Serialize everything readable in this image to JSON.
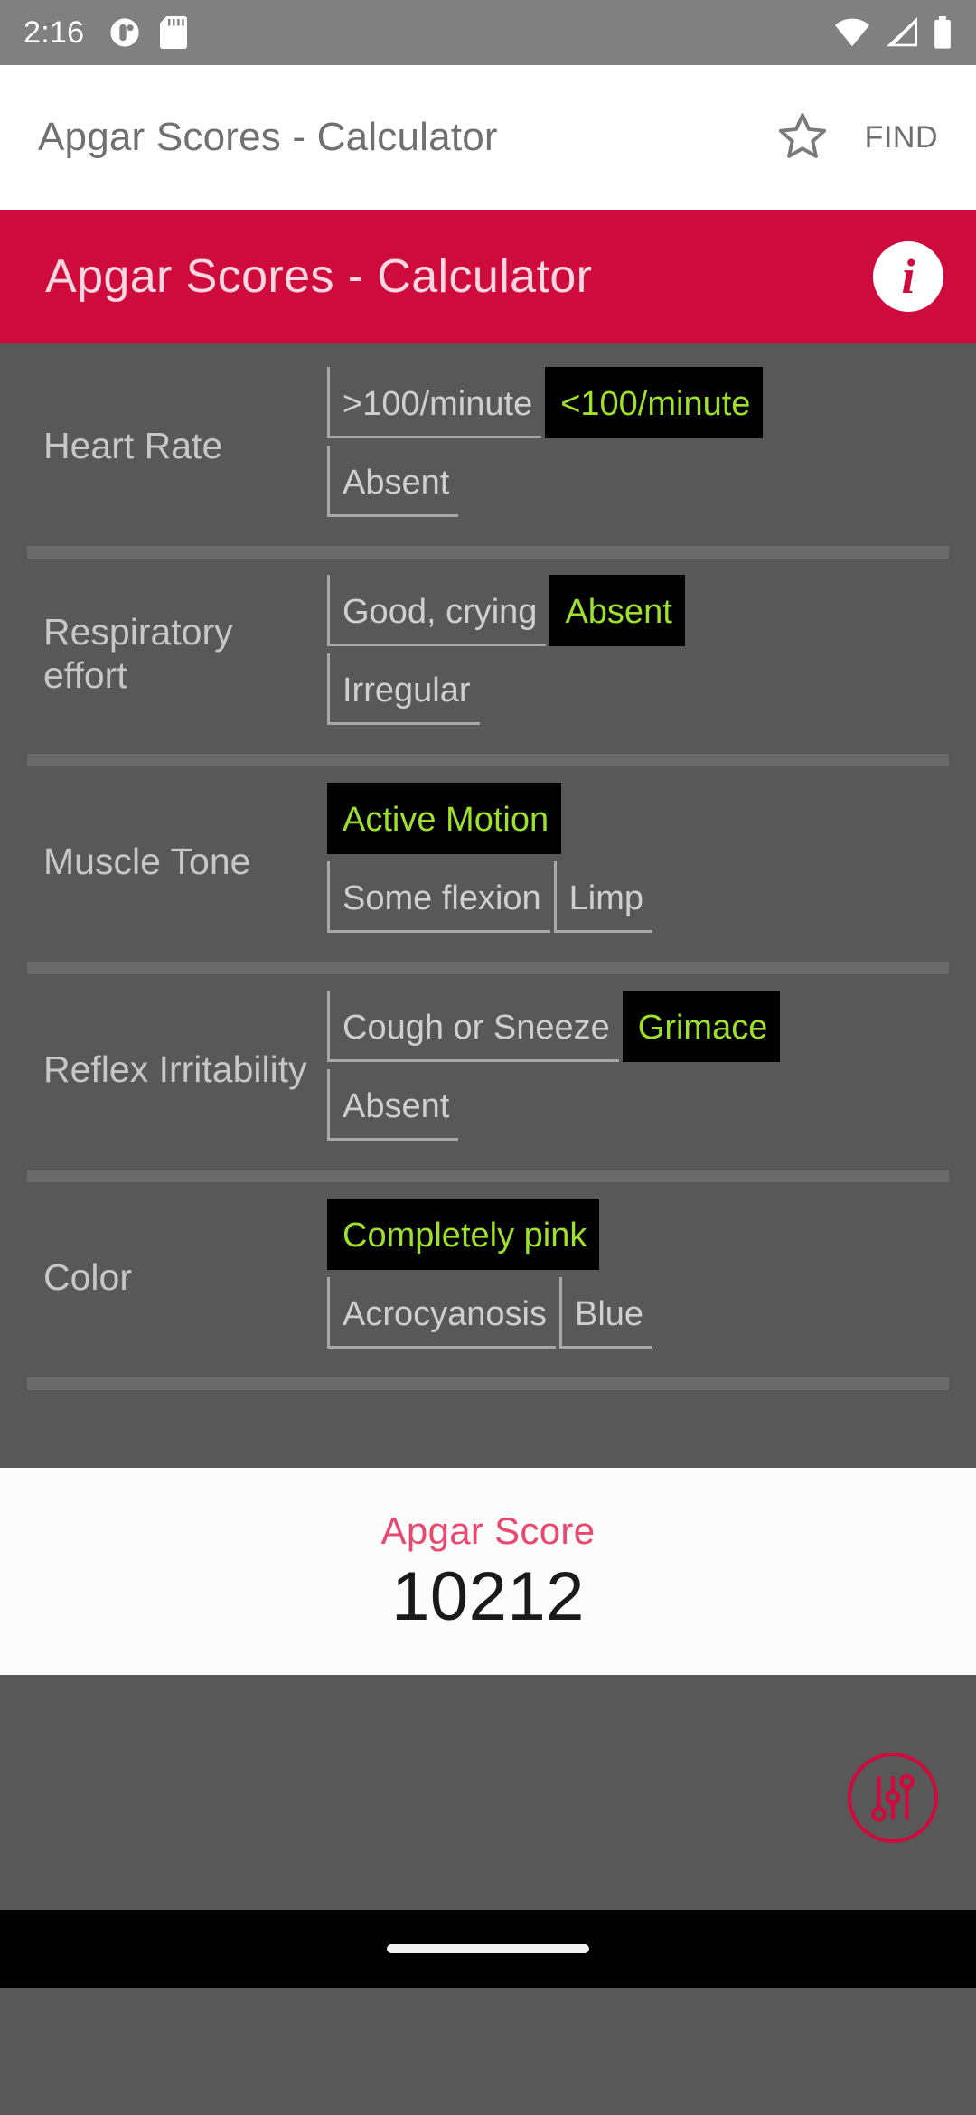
{
  "statusbar": {
    "clock": "2:16",
    "icons": [
      "notification-icon",
      "sd-card-icon",
      "wifi-icon",
      "cellular-signal-icon",
      "battery-icon"
    ]
  },
  "appbar": {
    "title": "Apgar Scores - Calculator",
    "star_icon": "star-outline-icon",
    "find_label": "FIND"
  },
  "header": {
    "title": "Apgar Scores - Calculator",
    "info_glyph": "i",
    "color": "#cf0a3c"
  },
  "colors": {
    "accent": "#cf0a3c",
    "selected_text": "#9ee02a",
    "selected_bg": "#000000",
    "body_bg": "#585858",
    "result_label": "#e8486e"
  },
  "parameters": [
    {
      "label": "Heart Rate",
      "options": [
        {
          "text": ">100/minute",
          "selected": false,
          "newline": false
        },
        {
          "text": "<100/minute",
          "selected": true,
          "newline": false
        },
        {
          "text": "Absent",
          "selected": false,
          "newline": true
        }
      ]
    },
    {
      "label": "Respiratory effort",
      "options": [
        {
          "text": "Good, crying",
          "selected": false,
          "newline": false
        },
        {
          "text": "Absent",
          "selected": true,
          "newline": false
        },
        {
          "text": "Irregular",
          "selected": false,
          "newline": true
        }
      ]
    },
    {
      "label": "Muscle Tone",
      "options": [
        {
          "text": "Active Motion",
          "selected": true,
          "newline": false
        },
        {
          "text": "Some flexion",
          "selected": false,
          "newline": true
        },
        {
          "text": "Limp",
          "selected": false,
          "newline": false
        }
      ]
    },
    {
      "label": "Reflex Irritability",
      "options": [
        {
          "text": "Cough or Sneeze",
          "selected": false,
          "newline": false
        },
        {
          "text": "Grimace",
          "selected": true,
          "newline": false
        },
        {
          "text": "Absent",
          "selected": false,
          "newline": true
        }
      ]
    },
    {
      "label": "Color",
      "options": [
        {
          "text": "Completely pink",
          "selected": true,
          "newline": false
        },
        {
          "text": "Acrocyanosis",
          "selected": false,
          "newline": true
        },
        {
          "text": "Blue",
          "selected": false,
          "newline": false
        }
      ]
    }
  ],
  "result": {
    "label": "Apgar Score",
    "value": "10212"
  },
  "fab": {
    "icon": "sliders-tuner-icon"
  }
}
